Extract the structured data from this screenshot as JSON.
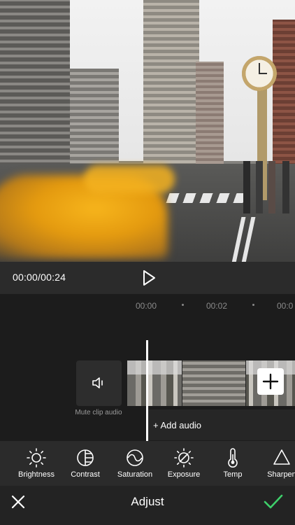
{
  "player": {
    "timecode": "00:00/00:24",
    "play_icon": "play-icon"
  },
  "timeline": {
    "ruler": [
      "00:00",
      "00:02",
      "00:0"
    ],
    "mute_label": "Mute clip audio",
    "mute_icon": "speaker-icon",
    "add_audio_label": "+ Add audio",
    "add_clip_icon": "plus-icon"
  },
  "tools": [
    {
      "label": "Brightness",
      "icon": "sun-icon"
    },
    {
      "label": "Contrast",
      "icon": "contrast-icon"
    },
    {
      "label": "Saturation",
      "icon": "saturation-icon"
    },
    {
      "label": "Exposure",
      "icon": "exposure-icon"
    },
    {
      "label": "Temp",
      "icon": "thermometer-icon"
    },
    {
      "label": "Sharpen",
      "icon": "triangle-icon"
    }
  ],
  "bottom_bar": {
    "title": "Adjust",
    "close_icon": "close-icon",
    "confirm_icon": "checkmark-icon"
  },
  "colors": {
    "accent": "#3ecf6a",
    "background": "#1c1c1c",
    "panel": "#2b2b2b"
  }
}
